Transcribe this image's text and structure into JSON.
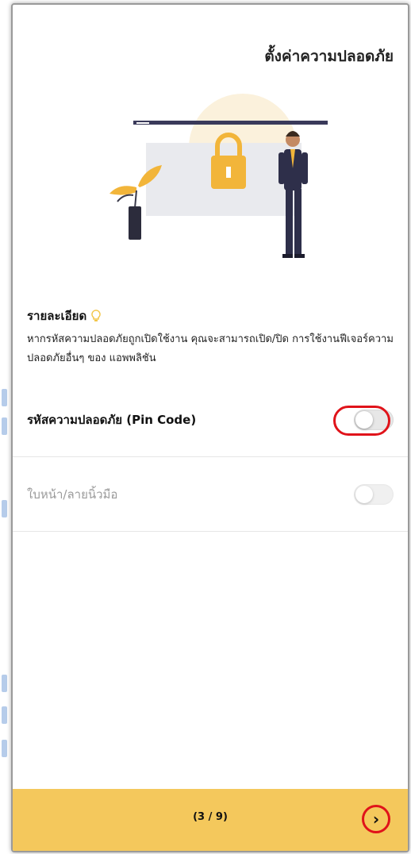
{
  "header": {
    "title": "ตั้งค่าความปลอดภัย"
  },
  "details": {
    "heading": "รายละเอียด",
    "icon": "bulb-icon",
    "body": "หากรหัสความปลอดภัยถูกเปิดใช้งาน คุณจะสามารถเปิด/ปิด การใช้งานฟีเจอร์ความปลอดภัยอื่นๆ ของ แอพพลิชัน"
  },
  "settings": [
    {
      "label": "รหัสความปลอดภัย (Pin Code)",
      "enabled": true,
      "on": false
    },
    {
      "label": "ใบหน้า/ลายนิ้วมือ",
      "enabled": false,
      "on": false
    }
  ],
  "footer": {
    "page_indicator": "(3 / 9)",
    "next_icon": "chevron-right-icon"
  },
  "colors": {
    "accent": "#f4c85c",
    "highlight": "#e0131a",
    "lock": "#f2b53a"
  }
}
